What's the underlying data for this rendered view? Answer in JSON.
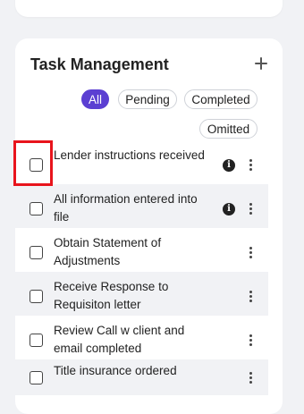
{
  "panel": {
    "title": "Task Management",
    "add_icon": "plus-icon"
  },
  "filters": {
    "selected": "All",
    "options": [
      "All",
      "Pending",
      "Completed",
      "Omitted"
    ]
  },
  "tasks": [
    {
      "label": "Lender instructions received",
      "checked": false,
      "has_info": true
    },
    {
      "label": "All information entered into file",
      "checked": false,
      "has_info": true
    },
    {
      "label": "Obtain Statement of Adjustments",
      "checked": false,
      "has_info": false
    },
    {
      "label": "Receive Response to Requisiton letter",
      "checked": false,
      "has_info": false
    },
    {
      "label": "Review Call w client and email completed",
      "checked": false,
      "has_info": false
    },
    {
      "label": "Title insurance ordered",
      "checked": false,
      "has_info": false
    }
  ],
  "icons": {
    "info": "info-icon",
    "more": "kebab-menu-icon",
    "info_glyph": "i"
  },
  "colors": {
    "accent": "#5b3fd2",
    "highlight": "#e8141c",
    "row_shade": "#f1f2f5"
  }
}
